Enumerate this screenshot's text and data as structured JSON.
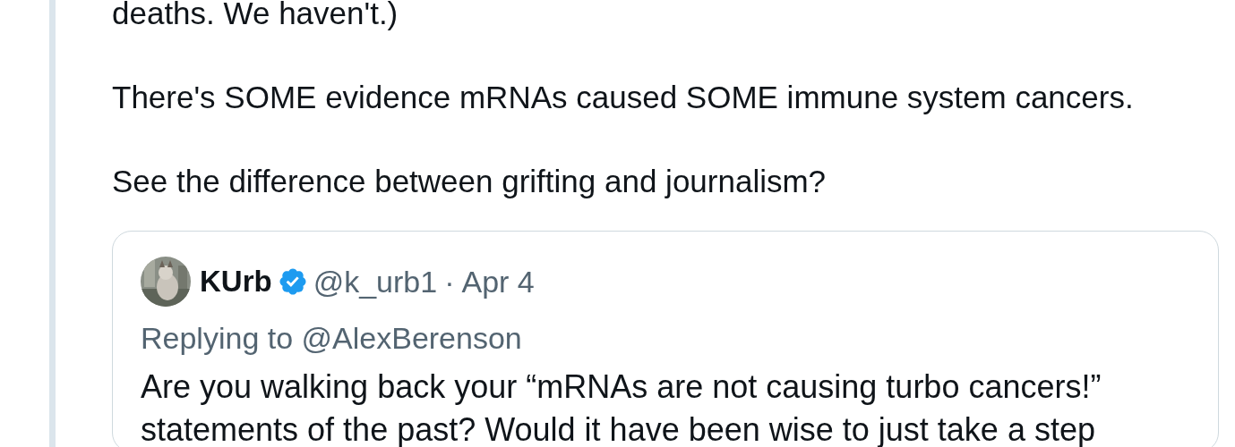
{
  "tweet": {
    "paragraphs": [
      "deaths. We haven't.)",
      "There's SOME evidence mRNAs caused SOME immune system cancers.",
      "See the difference between grifting and journalism?"
    ]
  },
  "quoted_tweet": {
    "avatar": {
      "kind": "picture"
    },
    "name": "KUrb",
    "verified": true,
    "handle": "@k_urb1",
    "separator": "·",
    "date": "Apr 4",
    "replying_to": "Replying to @AlexBerenson",
    "body_lines": [
      "Are you walking back your “mRNAs are not causing turbo cancers!”",
      "statements of the past? Would it have been wise to just take a step"
    ]
  }
}
